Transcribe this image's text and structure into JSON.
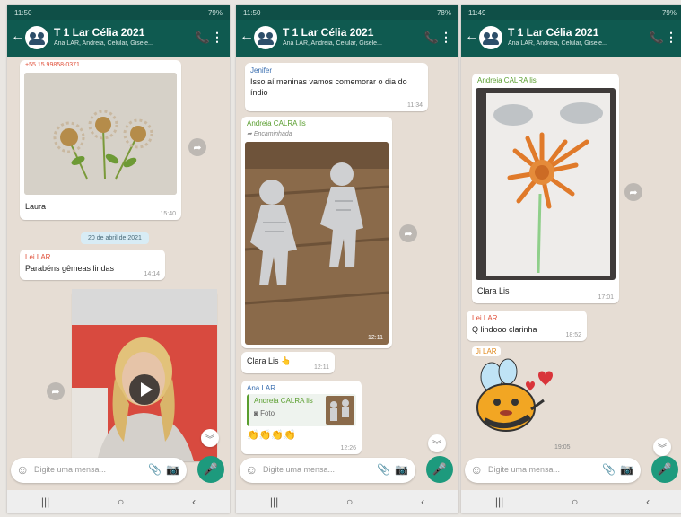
{
  "panels": [
    {
      "status": {
        "time": "11:50",
        "battery": "79%"
      },
      "header": {
        "title": "T 1 Lar Célia 2021",
        "subtitle": "Ana LAR, Andreia, Celular, Gisele..."
      },
      "top_number": "+55 15 99858-0371",
      "messages": {
        "laura_caption": "Laura",
        "laura_time": "15:40",
        "date_chip": "20 de abril de 2021",
        "lar_sender": "Lei LAR",
        "lar_text": "Parabéns gêmeas  lindas",
        "lar_time": "14:14"
      },
      "input_placeholder": "Digite uma mensa..."
    },
    {
      "status": {
        "time": "11:50",
        "battery": "78%"
      },
      "header": {
        "title": "T 1 Lar Célia 2021",
        "subtitle": "Ana LAR, Andreia, Celular, Gisele..."
      },
      "messages": {
        "jenifer_sender": "Jenifer",
        "jenifer_text": "Isso aí meninas vamos comemorar o dia do índio",
        "jenifer_time": "11:34",
        "andreia_sender": "Andreia CALRA lis",
        "forwarded_label": "Encaminhada",
        "photo_time": "12:11",
        "clara_text": "Clara Lis 👆",
        "clara_time": "12:11",
        "ana_sender": "Ana LAR",
        "quote_sender": "Andreia CALRA lis",
        "quote_text": "Foto",
        "reaction_emojis": "👏👏👏👏",
        "ana_time": "12:26"
      },
      "input_placeholder": "Digite uma mensa..."
    },
    {
      "status": {
        "time": "11:49",
        "battery": "79%"
      },
      "header": {
        "title": "T 1 Lar Célia 2021",
        "subtitle": "Ana LAR, Andreia, Celular, Gisele..."
      },
      "messages": {
        "andreia_sender": "Andreia CALRA lis",
        "clara_caption": "Clara Lis",
        "clara_time": "17:01",
        "lar_sender": "Lei LAR",
        "lar_text": "Q lindooo clarinha",
        "lar_time": "18:52",
        "ji_sender": "Ji LAR",
        "sticker_time": "19:05"
      },
      "input_placeholder": "Digite uma mensa..."
    }
  ],
  "icons": {
    "back": "←",
    "call": "📞",
    "menu": "⋮",
    "emoji": "☺",
    "clip": "📎",
    "camera": "📷",
    "mic": "🎤",
    "share": "➦",
    "scroll": "︾",
    "nav_recent": "|||",
    "nav_home": "○",
    "nav_back": "‹"
  },
  "colors": {
    "header": "#0f5a50",
    "mic": "#1d9a7d",
    "sender_red": "#e0513b",
    "sender_green": "#5a9e2f",
    "sender_blue": "#3b6fb0",
    "sender_orange": "#e08a1e"
  }
}
